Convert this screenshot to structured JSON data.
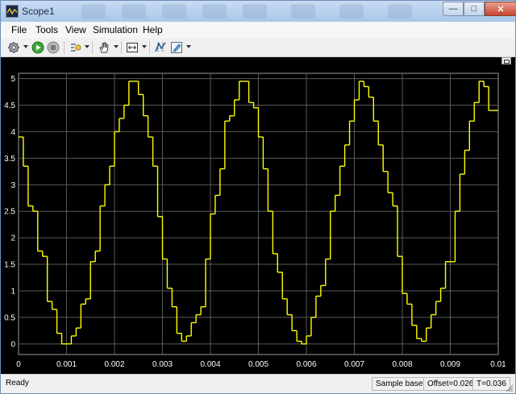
{
  "window": {
    "title": "Scope1",
    "controls": {
      "minimize": "—",
      "maximize": "□",
      "close": "✕"
    }
  },
  "menu": [
    "File",
    "Tools",
    "View",
    "Simulation",
    "Help"
  ],
  "toolbar": [
    "settings-icon",
    "run-icon",
    "stop-icon",
    "signal-selector-icon",
    "pan-icon",
    "zoom-fit-icon",
    "cursor-measurements-icon",
    "highlight-icon"
  ],
  "colors": {
    "plot_background": "#000000",
    "grid": "#5a5a5a",
    "trace": "#ffff00",
    "axis_text": "#ffffff"
  },
  "chart_data": {
    "type": "line",
    "step": true,
    "xlim": [
      0,
      0.01
    ],
    "ylim": [
      -0.2,
      5.1
    ],
    "grid": true,
    "x_ticks": [
      "0",
      "0.001",
      "0.002",
      "0.003",
      "0.004",
      "0.005",
      "0.006",
      "0.007",
      "0.008",
      "0.009",
      "0.01"
    ],
    "y_ticks": [
      "0",
      "0.5",
      "1",
      "1.5",
      "2",
      "2.5",
      "3",
      "3.5",
      "4",
      "4.5",
      "5"
    ],
    "series": [
      {
        "color": "#ffff00",
        "x": [
          0,
          0.0001,
          0.0002,
          0.0003,
          0.0004,
          0.0005,
          0.0006,
          0.0007,
          0.0008,
          0.0009,
          0.001,
          0.0011,
          0.0012,
          0.0013,
          0.0014,
          0.0015,
          0.0016,
          0.0017,
          0.0018,
          0.0019,
          0.002,
          0.0021,
          0.0022,
          0.0023,
          0.0024,
          0.0025,
          0.0026,
          0.0027,
          0.0028,
          0.0029,
          0.003,
          0.0031,
          0.0032,
          0.0033,
          0.0034,
          0.0035,
          0.0036,
          0.0037,
          0.0038,
          0.0039,
          0.004,
          0.0041,
          0.0042,
          0.0043,
          0.0044,
          0.0045,
          0.0046,
          0.0047,
          0.0048,
          0.0049,
          0.005,
          0.0051,
          0.0052,
          0.0053,
          0.0054,
          0.0055,
          0.0056,
          0.0057,
          0.0058,
          0.0059,
          0.006,
          0.0061,
          0.0062,
          0.0063,
          0.0064,
          0.0065,
          0.0066,
          0.0067,
          0.0068,
          0.0069,
          0.007,
          0.0071,
          0.0072,
          0.0073,
          0.0074,
          0.0075,
          0.0076,
          0.0077,
          0.0078,
          0.0079,
          0.008,
          0.0081,
          0.0082,
          0.0083,
          0.0084,
          0.0085,
          0.0086,
          0.0087,
          0.0088,
          0.0089,
          0.009,
          0.0091,
          0.0092,
          0.0093,
          0.0094,
          0.0095,
          0.0096,
          0.0097,
          0.0098,
          0.0099
        ],
        "values": [
          3.9,
          3.35,
          2.6,
          2.5,
          1.75,
          1.65,
          0.8,
          0.65,
          0.2,
          0.0,
          0.0,
          0.15,
          0.3,
          0.75,
          0.85,
          1.55,
          1.75,
          2.6,
          3.0,
          3.35,
          4.0,
          4.25,
          4.5,
          4.95,
          4.95,
          4.7,
          4.3,
          3.9,
          3.35,
          2.4,
          1.6,
          1.05,
          0.7,
          0.2,
          0.05,
          0.15,
          0.4,
          0.55,
          0.7,
          1.6,
          2.45,
          2.8,
          3.3,
          4.2,
          4.3,
          4.6,
          4.95,
          4.95,
          4.55,
          4.45,
          3.9,
          3.3,
          2.5,
          1.7,
          1.35,
          0.85,
          0.55,
          0.25,
          0.05,
          0.0,
          0.15,
          0.5,
          0.9,
          1.1,
          1.6,
          2.5,
          2.8,
          3.35,
          3.75,
          4.2,
          4.6,
          4.95,
          4.85,
          4.65,
          4.2,
          3.75,
          3.25,
          2.85,
          2.6,
          1.65,
          0.95,
          0.75,
          0.35,
          0.1,
          0.05,
          0.3,
          0.55,
          0.8,
          1.05,
          1.55,
          1.55,
          2.5,
          3.2,
          3.65,
          4.2,
          4.55,
          4.95,
          4.85,
          4.4,
          4.4
        ]
      }
    ]
  },
  "status": {
    "left": "Ready",
    "mode": "Sample based",
    "offset": "Offset=0.026",
    "time": "T=0.036"
  }
}
